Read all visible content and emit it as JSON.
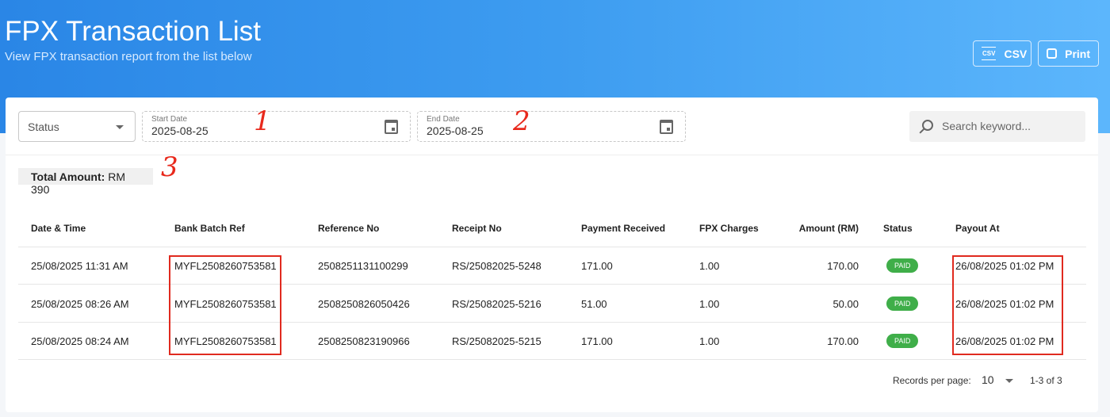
{
  "header": {
    "title": "FPX Transaction List",
    "subtitle": "View FPX transaction report from the list below",
    "csv_label": "CSV",
    "print_label": "Print"
  },
  "filters": {
    "status_placeholder": "Status",
    "start_date_label": "Start Date",
    "start_date": "2025-08-25",
    "end_date_label": "End Date",
    "end_date": "2025-08-25",
    "search_placeholder": "Search keyword..."
  },
  "total": {
    "label": "Total Amount:",
    "value": "RM 390"
  },
  "annotations": [
    "1",
    "2",
    "3"
  ],
  "table": {
    "columns": [
      "Date & Time",
      "Bank Batch Ref",
      "Reference No",
      "Receipt No",
      "Payment Received",
      "FPX Charges",
      "Amount (RM)",
      "Status",
      "Payout At"
    ],
    "rows": [
      [
        "25/08/2025 11:31 AM",
        "MYFL2508260753581",
        "2508251131100299",
        "RS/25082025-5248",
        "171.00",
        "1.00",
        "170.00",
        "PAID",
        "26/08/2025 01:02 PM"
      ],
      [
        "25/08/2025 08:26 AM",
        "MYFL2508260753581",
        "2508250826050426",
        "RS/25082025-5216",
        "51.00",
        "1.00",
        "50.00",
        "PAID",
        "26/08/2025 01:02 PM"
      ],
      [
        "25/08/2025 08:24 AM",
        "MYFL2508260753581",
        "2508250823190966",
        "RS/25082025-5215",
        "171.00",
        "1.00",
        "170.00",
        "PAID",
        "26/08/2025 01:02 PM"
      ]
    ]
  },
  "pagination": {
    "records_label": "Records per page:",
    "per_page": "10",
    "range": "1-3 of 3"
  }
}
